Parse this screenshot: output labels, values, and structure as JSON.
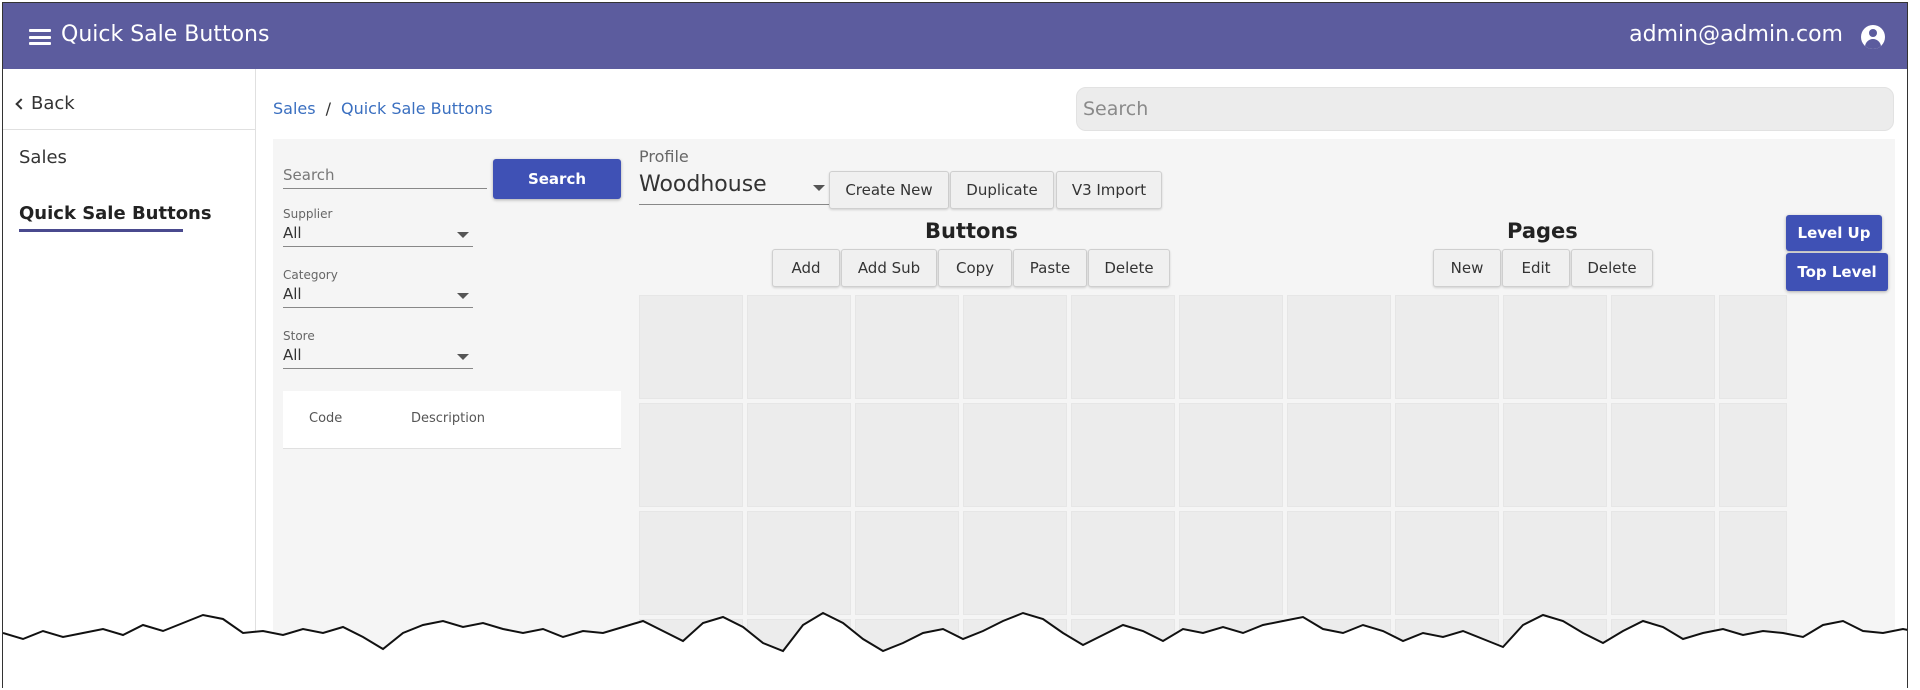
{
  "app": {
    "title": "Quick Sale Buttons",
    "user_email": "admin@admin.com",
    "accent_color": "#5c5c9e",
    "button_color": "#3f51b5"
  },
  "sidebar": {
    "back_label": "Back",
    "items": [
      {
        "label": "Sales",
        "active": false
      },
      {
        "label": "Quick Sale Buttons",
        "active": true
      }
    ]
  },
  "breadcrumb": {
    "items": [
      "Sales",
      "Quick Sale Buttons"
    ],
    "separator": "/"
  },
  "top_search": {
    "placeholder": "Search"
  },
  "filters": {
    "search_placeholder": "Search",
    "search_button": "Search",
    "supplier": {
      "label": "Supplier",
      "value": "All"
    },
    "category": {
      "label": "Category",
      "value": "All"
    },
    "store": {
      "label": "Store",
      "value": "All"
    },
    "table_headers": [
      "Code",
      "Description"
    ]
  },
  "profile": {
    "label": "Profile",
    "value": "Woodhouse",
    "actions": [
      "Create New",
      "Duplicate",
      "V3 Import"
    ]
  },
  "buttons_section": {
    "title": "Buttons",
    "actions": [
      "Add",
      "Add Sub",
      "Copy",
      "Paste",
      "Delete"
    ]
  },
  "pages_section": {
    "title": "Pages",
    "actions": [
      "New",
      "Edit",
      "Delete"
    ]
  },
  "level": {
    "level_up": "Level Up",
    "top_level": "Top Level"
  }
}
